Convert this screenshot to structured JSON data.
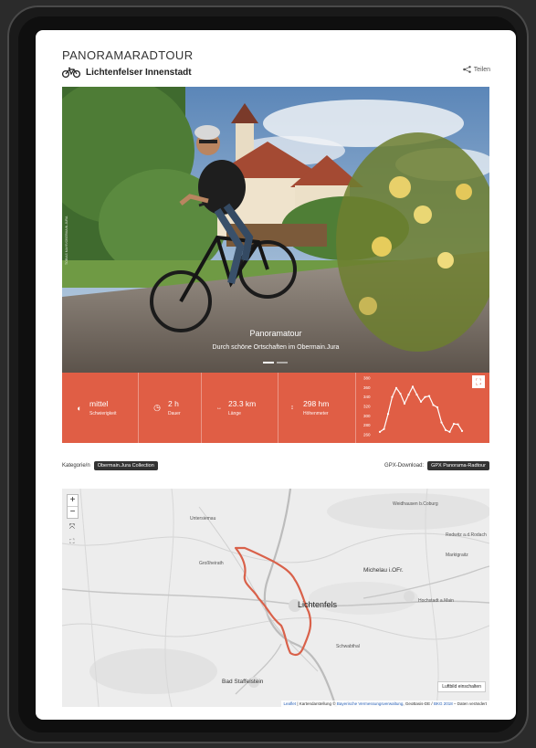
{
  "page": {
    "title": "PANORAMARADTOUR",
    "subtitle": "Lichtenfelser Innenstadt",
    "share_label": "Teilen"
  },
  "hero": {
    "title": "Panoramatour",
    "subtitle": "Durch schöne Ortschaften im Obermain.Jura",
    "credit": "TOBIAS MAYR/OBERMAIN.JURA"
  },
  "stats": {
    "difficulty": {
      "value": "mittel",
      "label": "Schwierigkeit"
    },
    "duration": {
      "value": "2 h",
      "label": "Dauer"
    },
    "length": {
      "value": "23.3 km",
      "label": "Länge"
    },
    "elevation": {
      "value": "298 hm",
      "label": "Höhenmeter"
    }
  },
  "chart_data": {
    "type": "line",
    "ylim": [
      260,
      380
    ],
    "yticks": [
      "380",
      "360",
      "340",
      "320",
      "300",
      "280",
      "260"
    ],
    "x": [
      0,
      1,
      2,
      3,
      4,
      5,
      6,
      7,
      8,
      9,
      10,
      11,
      12,
      13,
      14,
      15,
      16,
      17,
      18,
      19,
      20
    ],
    "values": [
      266,
      272,
      304,
      340,
      359,
      347,
      326,
      345,
      362,
      345,
      330,
      340,
      342,
      323,
      318,
      286,
      270,
      266,
      283,
      282,
      268
    ]
  },
  "categories": {
    "label": "Kategorie/n",
    "tag": "Obermain.Jura Collection"
  },
  "gpx": {
    "label": "GPX-Download:",
    "button": "GPX Panorama-Radtour"
  },
  "map": {
    "zoom_in": "+",
    "zoom_out": "−",
    "toggle_button": "Luftbild einschalten",
    "attribution_leaflet": "Leaflet",
    "attribution_mid": "| Kartendarstellung ©",
    "attribution_bv": "Bayerische Vermessungsverwaltung",
    "attribution_end": ", GeoBasis-DE /",
    "attribution_bkg": "BKG 2018",
    "attribution_tail": "– Daten verändert",
    "labels": {
      "lichtenfels": "Lichtenfels",
      "michelau": "Michelau i.OFr.",
      "bad_staffelstein": "Bad Staffelstein",
      "grossheirath": "Großheirath",
      "weidhausen": "Weidhausen b.Coburg",
      "marktgraitz": "Marktgraitz",
      "hochstadt": "Hochstadt a.Main",
      "redwitz": "Redwitz a.d.Rodach",
      "untersiemau": "Untersiemau",
      "schwabthal": "Schwabthal"
    }
  }
}
